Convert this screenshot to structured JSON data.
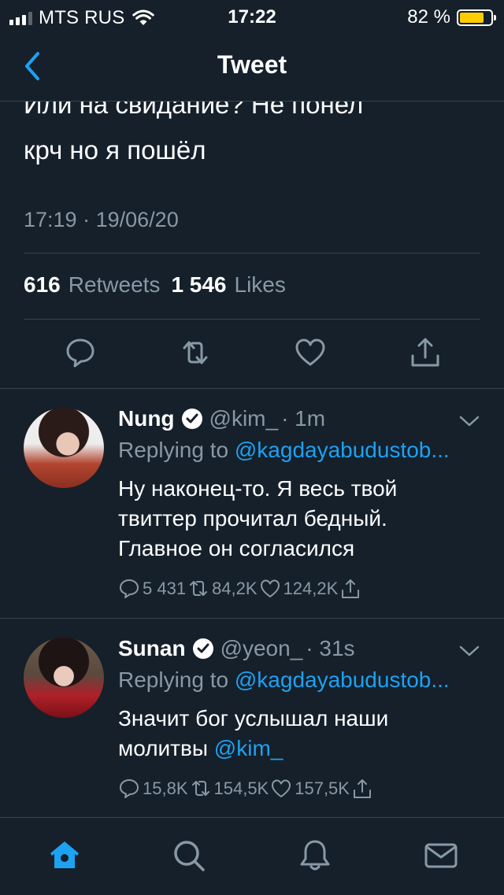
{
  "status_bar": {
    "carrier": "MTS RUS",
    "time": "17:22",
    "battery": "82 %",
    "battery_level": 0.82,
    "battery_color": "#ffcc00"
  },
  "nav": {
    "title": "Tweet",
    "back_icon": "chevron-left-icon"
  },
  "tweet": {
    "text_line1": "Или на свидание? Не понел",
    "text_line2": "крч но я пошёл",
    "time": "17:19",
    "separator": "·",
    "date": "19/06/20",
    "retweets_count": "616",
    "retweets_label": "Retweets",
    "likes_count": "1 546",
    "likes_label": "Likes",
    "actions": [
      "reply-icon",
      "retweet-icon",
      "like-icon",
      "share-icon"
    ]
  },
  "replies": [
    {
      "name": "Nung",
      "handle": "@kim_",
      "time": "· 1m",
      "replying_label": "Replying to",
      "replying_to": "@kagdayabudustob...",
      "text": [
        "Ну наконец-то. Я весь твой",
        "твиттер прочитал бедный.",
        "Главное он согласился"
      ],
      "replies": "5 431",
      "retweets": "84,2K",
      "likes": "124,2K"
    },
    {
      "name": "Sunan",
      "handle": "@yeon_",
      "time": "· 31s",
      "replying_label": "Replying to",
      "replying_to": "@kagdayabudustob...",
      "text_line1": "Значит бог услышал наши",
      "text_line2_prefix": "молитвы",
      "text_line2_mention": "@kim_",
      "replies": "15,8K",
      "retweets": "154,5K",
      "likes": "157,5K"
    }
  ],
  "tabbar": [
    "home-icon",
    "search-icon",
    "notifications-icon",
    "messages-icon"
  ],
  "colors": {
    "background": "#15202b",
    "accent": "#1da1f2",
    "muted": "#8899a6",
    "divider": "#38444d"
  }
}
